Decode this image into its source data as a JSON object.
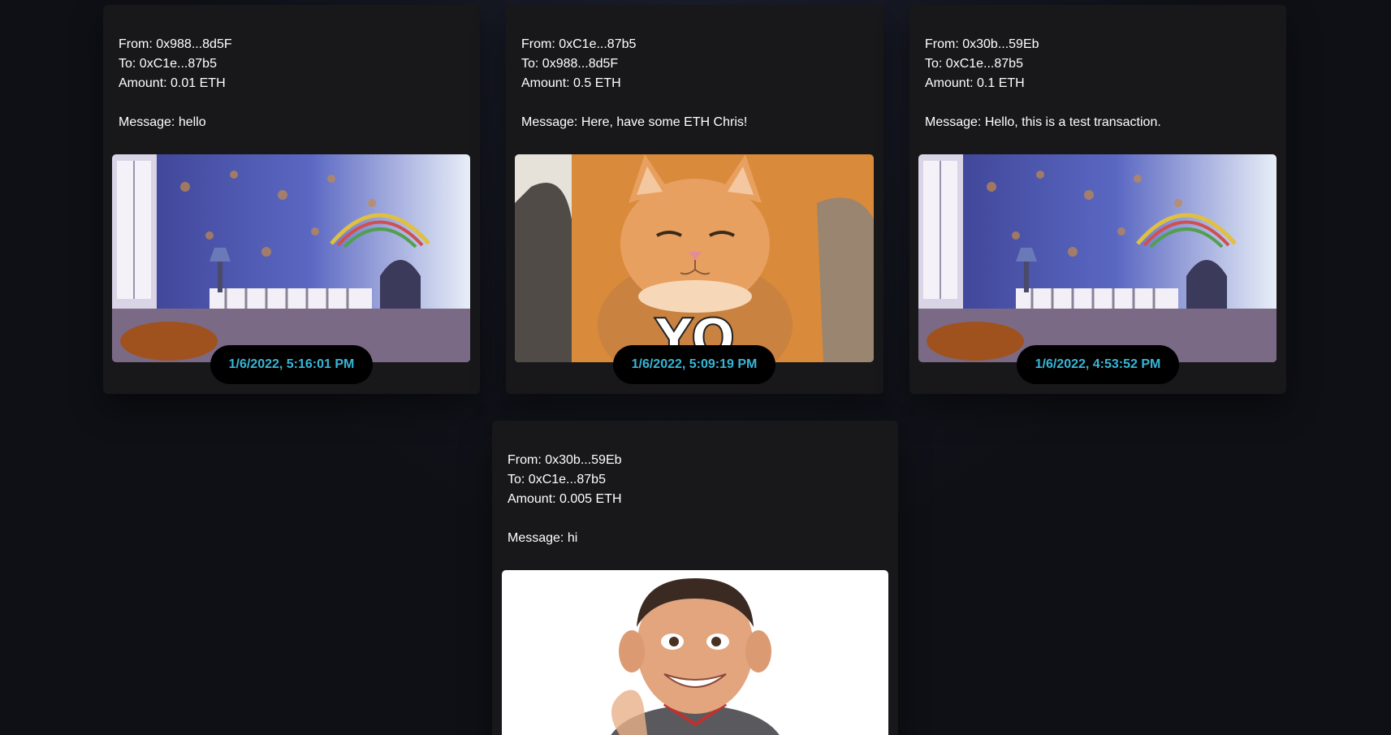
{
  "transactions": [
    {
      "from": "From: 0x988...8d5F",
      "to": "To: 0xC1e...87b5",
      "amount": "Amount: 0.01 ETH",
      "message": "Message: hello",
      "timestamp": "1/6/2022, 5:16:01 PM",
      "gif": "toy-story-room-gif"
    },
    {
      "from": "From: 0xC1e...87b5",
      "to": "To: 0x988...8d5F",
      "amount": "Amount: 0.5 ETH",
      "message": "Message: Here, have some ETH Chris!",
      "timestamp": "1/6/2022, 5:09:19 PM",
      "gif": "cat-yo-gif",
      "gif_caption": "YO"
    },
    {
      "from": "From: 0x30b...59Eb",
      "to": "To: 0xC1e...87b5",
      "amount": "Amount: 0.1 ETH",
      "message": "Message: Hello, this is a test transaction.",
      "timestamp": "1/6/2022, 4:53:52 PM",
      "gif": "toy-story-room-gif"
    },
    {
      "from": "From: 0x30b...59Eb",
      "to": "To: 0xC1e...87b5",
      "amount": "Amount: 0.005 ETH",
      "message": "Message: hi",
      "gif": "waving-kid-gif"
    }
  ],
  "colors": {
    "background": "#0f1016",
    "card": "#18181a",
    "timestamp_text": "#37b6d6",
    "timestamp_bg": "#000000"
  }
}
